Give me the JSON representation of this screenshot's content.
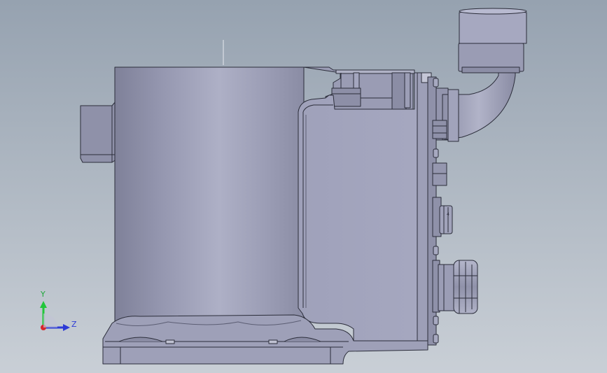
{
  "viewport": {
    "background_top": "#96a2b0",
    "background_bottom": "#c9cfd6"
  },
  "model": {
    "outline_color": "#2b2d3a",
    "face_color": "#a4a6bf",
    "face_dark": "#7f8199",
    "face_light": "#b8bad0"
  },
  "triad": {
    "y_label": "Y",
    "z_label": "Z",
    "y_color": "#22c63b",
    "z_color": "#2d3bd6",
    "x_color": "#d6262d"
  }
}
